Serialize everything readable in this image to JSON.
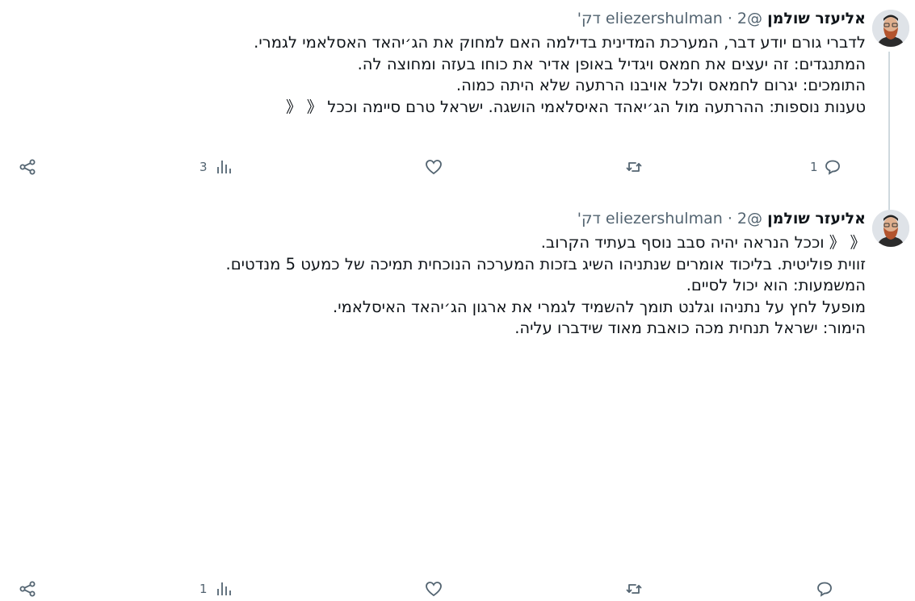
{
  "thread": [
    {
      "author_name": "אליעזר שולמן",
      "handle": "@eliezershulman",
      "separator": "·",
      "time": "2 דק'",
      "lines": [
        "לדברי גורם יודע דבר, המערכת המדינית בדילמה האם למחוק את הג׳יהאד האסלאמי לגמרי.",
        "המתנגדים: זה יעצים את חמאס ויגדיל באופן אדיר את כוחו בעזה ומחוצה לה.",
        "התומכים:  יגרום לחמאס ולכל אויבנו הרתעה שלא היתה כמוה.",
        "טענות נוספות: ההרתעה מול הג׳יאהד האיסלאמי הושגה. ישראל טרם סיימה וככל 《 《"
      ],
      "stats": {
        "replies": "1",
        "retweets": "",
        "likes": "",
        "views": "3"
      }
    },
    {
      "author_name": "אליעזר שולמן",
      "handle": "@eliezershulman",
      "separator": "·",
      "time": "2 דק'",
      "lines": [
        "《 《  וככל הנראה יהיה סבב נוסף בעתיד הקרוב.",
        "זווית פוליטית. בליכוד אומרים שנתניהו השיג בזכות המערכה הנוכחית תמיכה של כמעט 5 מנדטים.",
        "המשמעות: הוא יכול לסיים.",
        "מופעל לחץ על נתניהו וגלנט תומך להשמיד לגמרי את ארגון הג׳יהאד האיסלאמי.",
        "הימור: ישראל תנחית מכה כואבת מאוד שידברו עליה."
      ],
      "stats": {
        "replies": "",
        "retweets": "",
        "likes": "",
        "views": "1"
      }
    }
  ],
  "icons": {
    "reply": "reply-bubble-icon",
    "retweet": "retweet-icon",
    "like": "heart-icon",
    "views": "views-chart-icon",
    "share": "share-icon"
  },
  "colors": {
    "text": "#0f1419",
    "muted": "#536471",
    "thread_line": "#cfd9de"
  }
}
